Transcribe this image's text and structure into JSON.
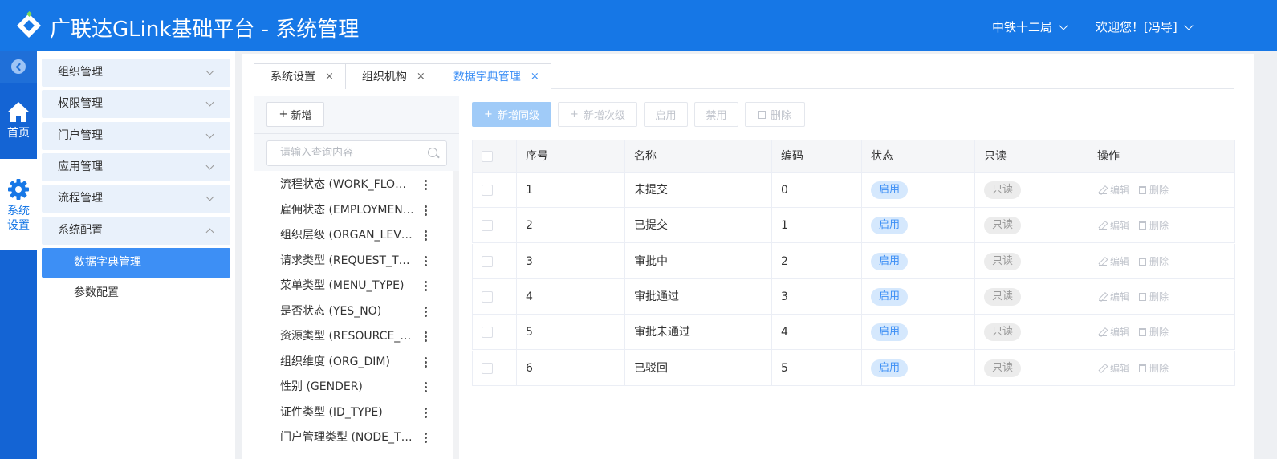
{
  "header": {
    "title": "广联达GLink基础平台 - 系统管理",
    "org_selector": "中铁十二局",
    "user_greeting": "欢迎您！[冯导]"
  },
  "rail": {
    "home_label": "首页",
    "settings_label": "系统设置"
  },
  "sidebar": {
    "items": [
      {
        "label": "组织管理",
        "expanded": false
      },
      {
        "label": "权限管理",
        "expanded": false
      },
      {
        "label": "门户管理",
        "expanded": false
      },
      {
        "label": "应用管理",
        "expanded": false
      },
      {
        "label": "流程管理",
        "expanded": false
      },
      {
        "label": "系统配置",
        "expanded": true
      }
    ],
    "sub_items": [
      {
        "label": "数据字典管理",
        "active": true
      },
      {
        "label": "参数配置",
        "active": false
      }
    ]
  },
  "tabs": [
    {
      "label": "系统设置",
      "close": "×",
      "active": false
    },
    {
      "label": "组织机构",
      "close": "×",
      "active": false
    },
    {
      "label": "数据字典管理",
      "close": "×",
      "active": true
    }
  ],
  "dict_panel": {
    "add_button": "新增",
    "search_placeholder": "请输入查询内容",
    "items": [
      "流程状态 (WORK_FLOW_STATUS)",
      "雇佣状态 (EMPLOYMENT_STATUS)",
      "组织层级 (ORGAN_LEVEL)",
      "请求类型 (REQUEST_TYPE)",
      "菜单类型 (MENU_TYPE)",
      "是否状态 (YES_NO)",
      "资源类型 (RESOURCE_TYPE)",
      "组织维度 (ORG_DIM)",
      "性别 (GENDER)",
      "证件类型 (ID_TYPE)",
      "门户管理类型 (NODE_TYPE)"
    ]
  },
  "toolbar": {
    "add_sibling": "新增同级",
    "add_child": "新增次级",
    "enable": "启用",
    "disable": "禁用",
    "delete": "删除"
  },
  "table": {
    "columns": [
      "序号",
      "名称",
      "编码",
      "状态",
      "只读",
      "操作"
    ],
    "rows": [
      {
        "index": "1",
        "name": "未提交",
        "code": "0",
        "status": "启用",
        "readonly": "只读"
      },
      {
        "index": "2",
        "name": "已提交",
        "code": "1",
        "status": "启用",
        "readonly": "只读"
      },
      {
        "index": "3",
        "name": "审批中",
        "code": "2",
        "status": "启用",
        "readonly": "只读"
      },
      {
        "index": "4",
        "name": "审批通过",
        "code": "3",
        "status": "启用",
        "readonly": "只读"
      },
      {
        "index": "5",
        "name": "审批未通过",
        "code": "4",
        "status": "启用",
        "readonly": "只读"
      },
      {
        "index": "6",
        "name": "已驳回",
        "code": "5",
        "status": "启用",
        "readonly": "只读"
      }
    ],
    "edit_label": "编辑",
    "delete_label": "删除"
  },
  "colors": {
    "brand": "#1677e6",
    "active": "#3d8ff5"
  }
}
